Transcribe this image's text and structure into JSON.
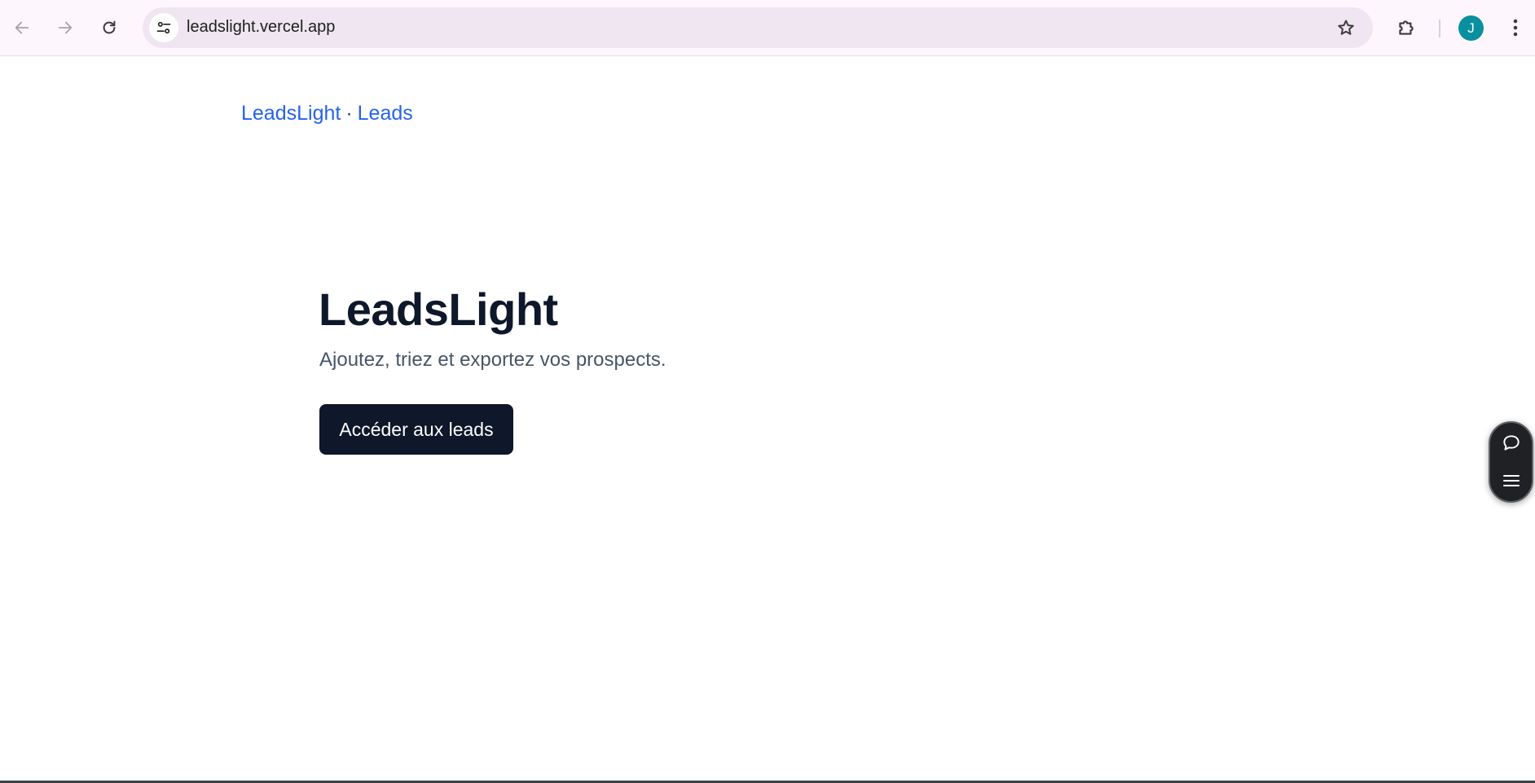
{
  "browser": {
    "url": "leadslight.vercel.app",
    "profile_initial": "J",
    "icons": {
      "back": "arrow-left-icon",
      "forward": "arrow-right-icon",
      "reload": "reload-icon",
      "site_info": "tune-icon",
      "bookmark": "star-icon",
      "extensions": "puzzle-icon",
      "menu": "kebab-menu-icon"
    },
    "colors": {
      "toolbar_bg": "#fdf6fd",
      "omnibox_bg": "#efe6f1",
      "avatar_bg": "#0a8f9e"
    }
  },
  "breadcrumb": {
    "home_label": "LeadsLight",
    "separator": "·",
    "leads_label": "Leads"
  },
  "hero": {
    "title": "LeadsLight",
    "subtitle": "Ajoutez, triez et exportez vos prospects.",
    "cta_label": "Accéder aux leads"
  },
  "side_widget": {
    "icons": [
      "chat-bubble-icon",
      "hamburger-menu-icon"
    ]
  },
  "theme": {
    "link_color": "#2563eb",
    "title_color": "#0f172a",
    "subtitle_color": "#475569",
    "button_bg": "#0f172a",
    "button_text": "#ffffff"
  }
}
